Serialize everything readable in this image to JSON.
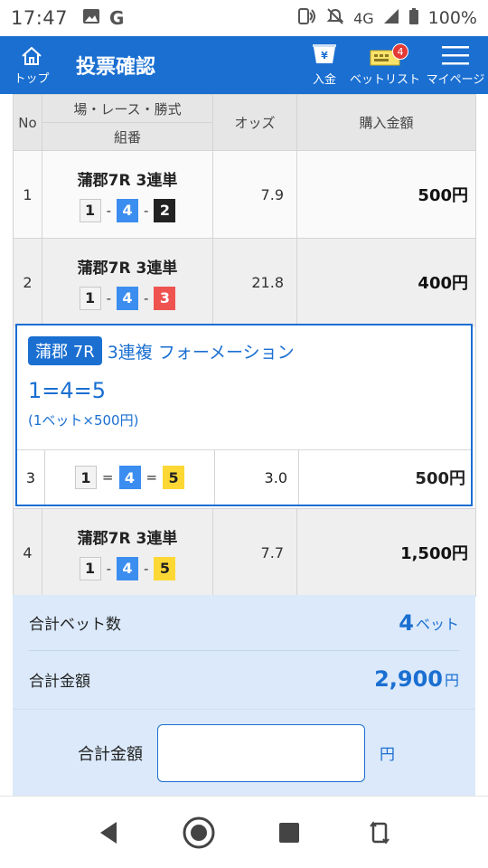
{
  "status": {
    "time": "17:47",
    "network": "4G",
    "battery": "100%",
    "icons": [
      "image-icon",
      "google-g-icon",
      "nfc-icon",
      "mute-icon",
      "signal-icon",
      "battery-icon"
    ]
  },
  "header": {
    "home_label": "トップ",
    "title": "投票確認",
    "deposit_label": "入金",
    "betlist_label": "ベットリスト",
    "betlist_badge": "4",
    "mypage_label": "マイページ",
    "color": "#1a6fd1"
  },
  "table": {
    "head": {
      "no": "No",
      "race": "場・レース・勝式",
      "combo": "組番",
      "odds": "オッズ",
      "amount": "購入金額"
    },
    "rows": [
      {
        "no": "1",
        "race": "蒲郡7R 3連単",
        "combo": [
          "1",
          "4",
          "2"
        ],
        "sep": "-",
        "odds": "7.9",
        "amount": "500円"
      },
      {
        "no": "2",
        "race": "蒲郡7R 3連単",
        "combo": [
          "1",
          "4",
          "3"
        ],
        "sep": "-",
        "odds": "21.8",
        "amount": "400円"
      },
      {
        "no": "4",
        "race": "蒲郡7R 3連単",
        "combo": [
          "1",
          "4",
          "5"
        ],
        "sep": "-",
        "odds": "7.7",
        "amount": "1,500円"
      }
    ]
  },
  "formation": {
    "venue": "蒲郡 7R",
    "bet_type": "3連複 フォーメーション",
    "combination": "1=4=5",
    "detail": "(1ベット×500円)",
    "row": {
      "no": "3",
      "combo": [
        "1",
        "4",
        "5"
      ],
      "sep": "=",
      "odds": "3.0",
      "amount": "500円"
    }
  },
  "summary": {
    "bet_count_label": "合計ベット数",
    "bet_count_value": "4",
    "bet_count_unit": "ベット",
    "total_label": "合計金額",
    "total_value": "2,900",
    "total_unit": "円"
  },
  "confirm": {
    "label": "合計金額",
    "input_value": "",
    "unit": "円"
  },
  "colors": {
    "boat1": "#f3f3f3",
    "boat2": "#222222",
    "boat3": "#ef5350",
    "boat4": "#3c8df0",
    "boat5": "#fdd835",
    "summary_bg": "#dbe9fa"
  }
}
